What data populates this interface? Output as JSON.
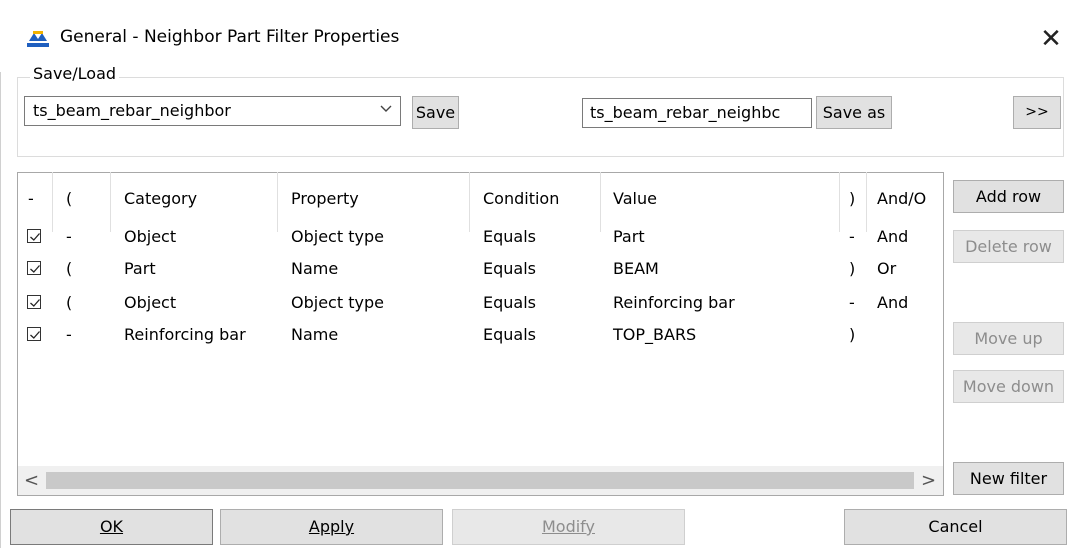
{
  "window": {
    "title": "General - Neighbor Part Filter Properties",
    "close_glyph": "✕"
  },
  "save_load": {
    "group_label": "Save/Load",
    "combo_value": "ts_beam_rebar_neighbor",
    "save_label": "Save",
    "save_as_value": "ts_beam_rebar_neighbc",
    "save_as_label": "Save as",
    "expand_label": ">>"
  },
  "grid": {
    "headers": [
      "-",
      "(",
      "Category",
      "Property",
      "Condition",
      "Value",
      ")",
      "And/O"
    ],
    "rows": [
      {
        "checked": true,
        "c0": "-",
        "category": "Object",
        "property": "Object type",
        "condition": "Equals",
        "value": "Part",
        "c1": "-",
        "andor": "And"
      },
      {
        "checked": true,
        "c0": "(",
        "category": "Part",
        "property": "Name",
        "condition": "Equals",
        "value": "BEAM",
        "c1": ")",
        "andor": "Or"
      },
      {
        "checked": true,
        "c0": "(",
        "category": "Object",
        "property": "Object type",
        "condition": "Equals",
        "value": "Reinforcing bar",
        "c1": "-",
        "andor": "And"
      },
      {
        "checked": true,
        "c0": "-",
        "category": "Reinforcing bar",
        "property": "Name",
        "condition": "Equals",
        "value": "TOP_BARS",
        "c1": ")",
        "andor": ""
      }
    ],
    "scroll_left": "<",
    "scroll_right": ">"
  },
  "side_buttons": {
    "add_row": "Add row",
    "delete_row": "Delete row",
    "move_up": "Move up",
    "move_down": "Move down",
    "new_filter": "New filter"
  },
  "footer": {
    "ok": "OK",
    "apply": "Apply",
    "modify": "Modify",
    "cancel": "Cancel"
  },
  "colors": {
    "icon_blue": "#1f5fbf",
    "icon_yellow": "#f2b200"
  }
}
